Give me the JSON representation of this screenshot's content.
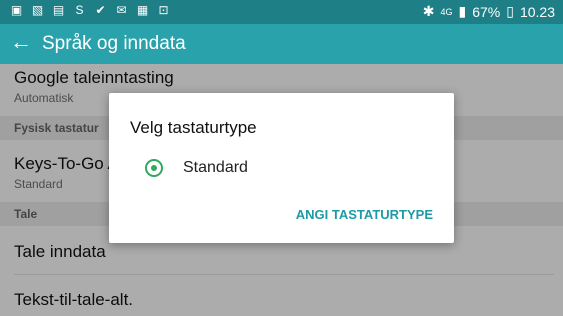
{
  "status_bar": {
    "battery_percent": "67%",
    "time": "10.23",
    "network": "4G",
    "icons_left": [
      "notification-icon",
      "gallery-icon",
      "calendar-icon",
      "s-icon",
      "check-icon",
      "mail-icon",
      "briefcase-icon",
      "store-icon"
    ],
    "icons_right": [
      "bluetooth-icon",
      "signal-icon",
      "battery-icon"
    ]
  },
  "app_bar": {
    "title": "Språk og inndata"
  },
  "list": {
    "google_voice": {
      "title": "Google taleinntasting",
      "subtitle": "Automatisk"
    },
    "section_physical": "Fysisk tastatur",
    "keys_to_go": {
      "title": "Keys-To-Go A",
      "subtitle": "Standard"
    },
    "section_voice": "Tale",
    "voice_input": "Tale inndata",
    "tts": "Tekst-til-tale-alt."
  },
  "dialog": {
    "title": "Velg tastaturtype",
    "option": "Standard",
    "action": "ANGI TASTATURTYPE"
  },
  "colors": {
    "appbar": "#2aa2ab",
    "statusbar": "#1f7f87",
    "accent": "#1e9aa6",
    "radio": "#2ea95f"
  }
}
